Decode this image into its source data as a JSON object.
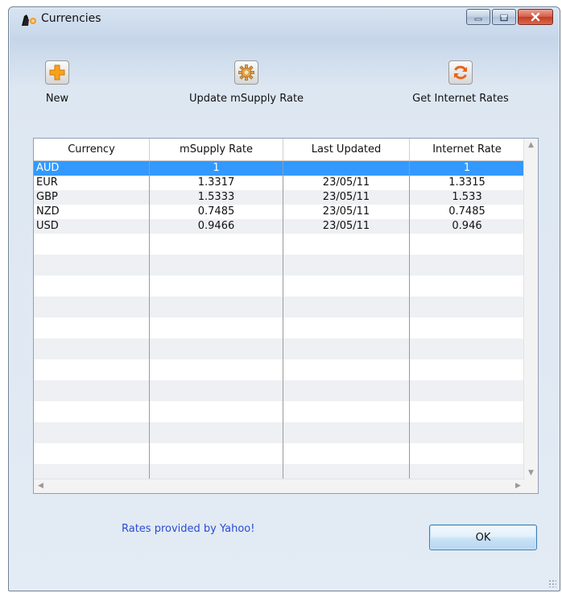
{
  "window": {
    "title": "Currencies",
    "icons": {
      "app": "msupply-app-icon",
      "minimize": "minimize-icon",
      "maximize": "maximize-icon",
      "close": "close-icon"
    }
  },
  "toolbar": {
    "new_label": "New",
    "new_icon": "plus-icon",
    "update_label": "Update mSupply Rate",
    "update_icon": "gear-icon",
    "internet_label": "Get Internet Rates",
    "internet_icon": "refresh-icon"
  },
  "table": {
    "columns": [
      "Currency",
      "mSupply Rate",
      "Last Updated",
      "Internet Rate"
    ],
    "rows": [
      {
        "currency": "AUD",
        "msupply_rate": "1",
        "last_updated": "",
        "internet_rate": "1",
        "selected": true
      },
      {
        "currency": "EUR",
        "msupply_rate": "1.3317",
        "last_updated": "23/05/11",
        "internet_rate": "1.3315"
      },
      {
        "currency": "GBP",
        "msupply_rate": "1.5333",
        "last_updated": "23/05/11",
        "internet_rate": "1.533"
      },
      {
        "currency": "NZD",
        "msupply_rate": "0.7485",
        "last_updated": "23/05/11",
        "internet_rate": "0.7485"
      },
      {
        "currency": "USD",
        "msupply_rate": "0.9466",
        "last_updated": "23/05/11",
        "internet_rate": "0.946"
      }
    ],
    "selected_color": "#3399ff"
  },
  "footer": {
    "credit": "Rates provided by Yahoo!",
    "ok_label": "OK"
  }
}
